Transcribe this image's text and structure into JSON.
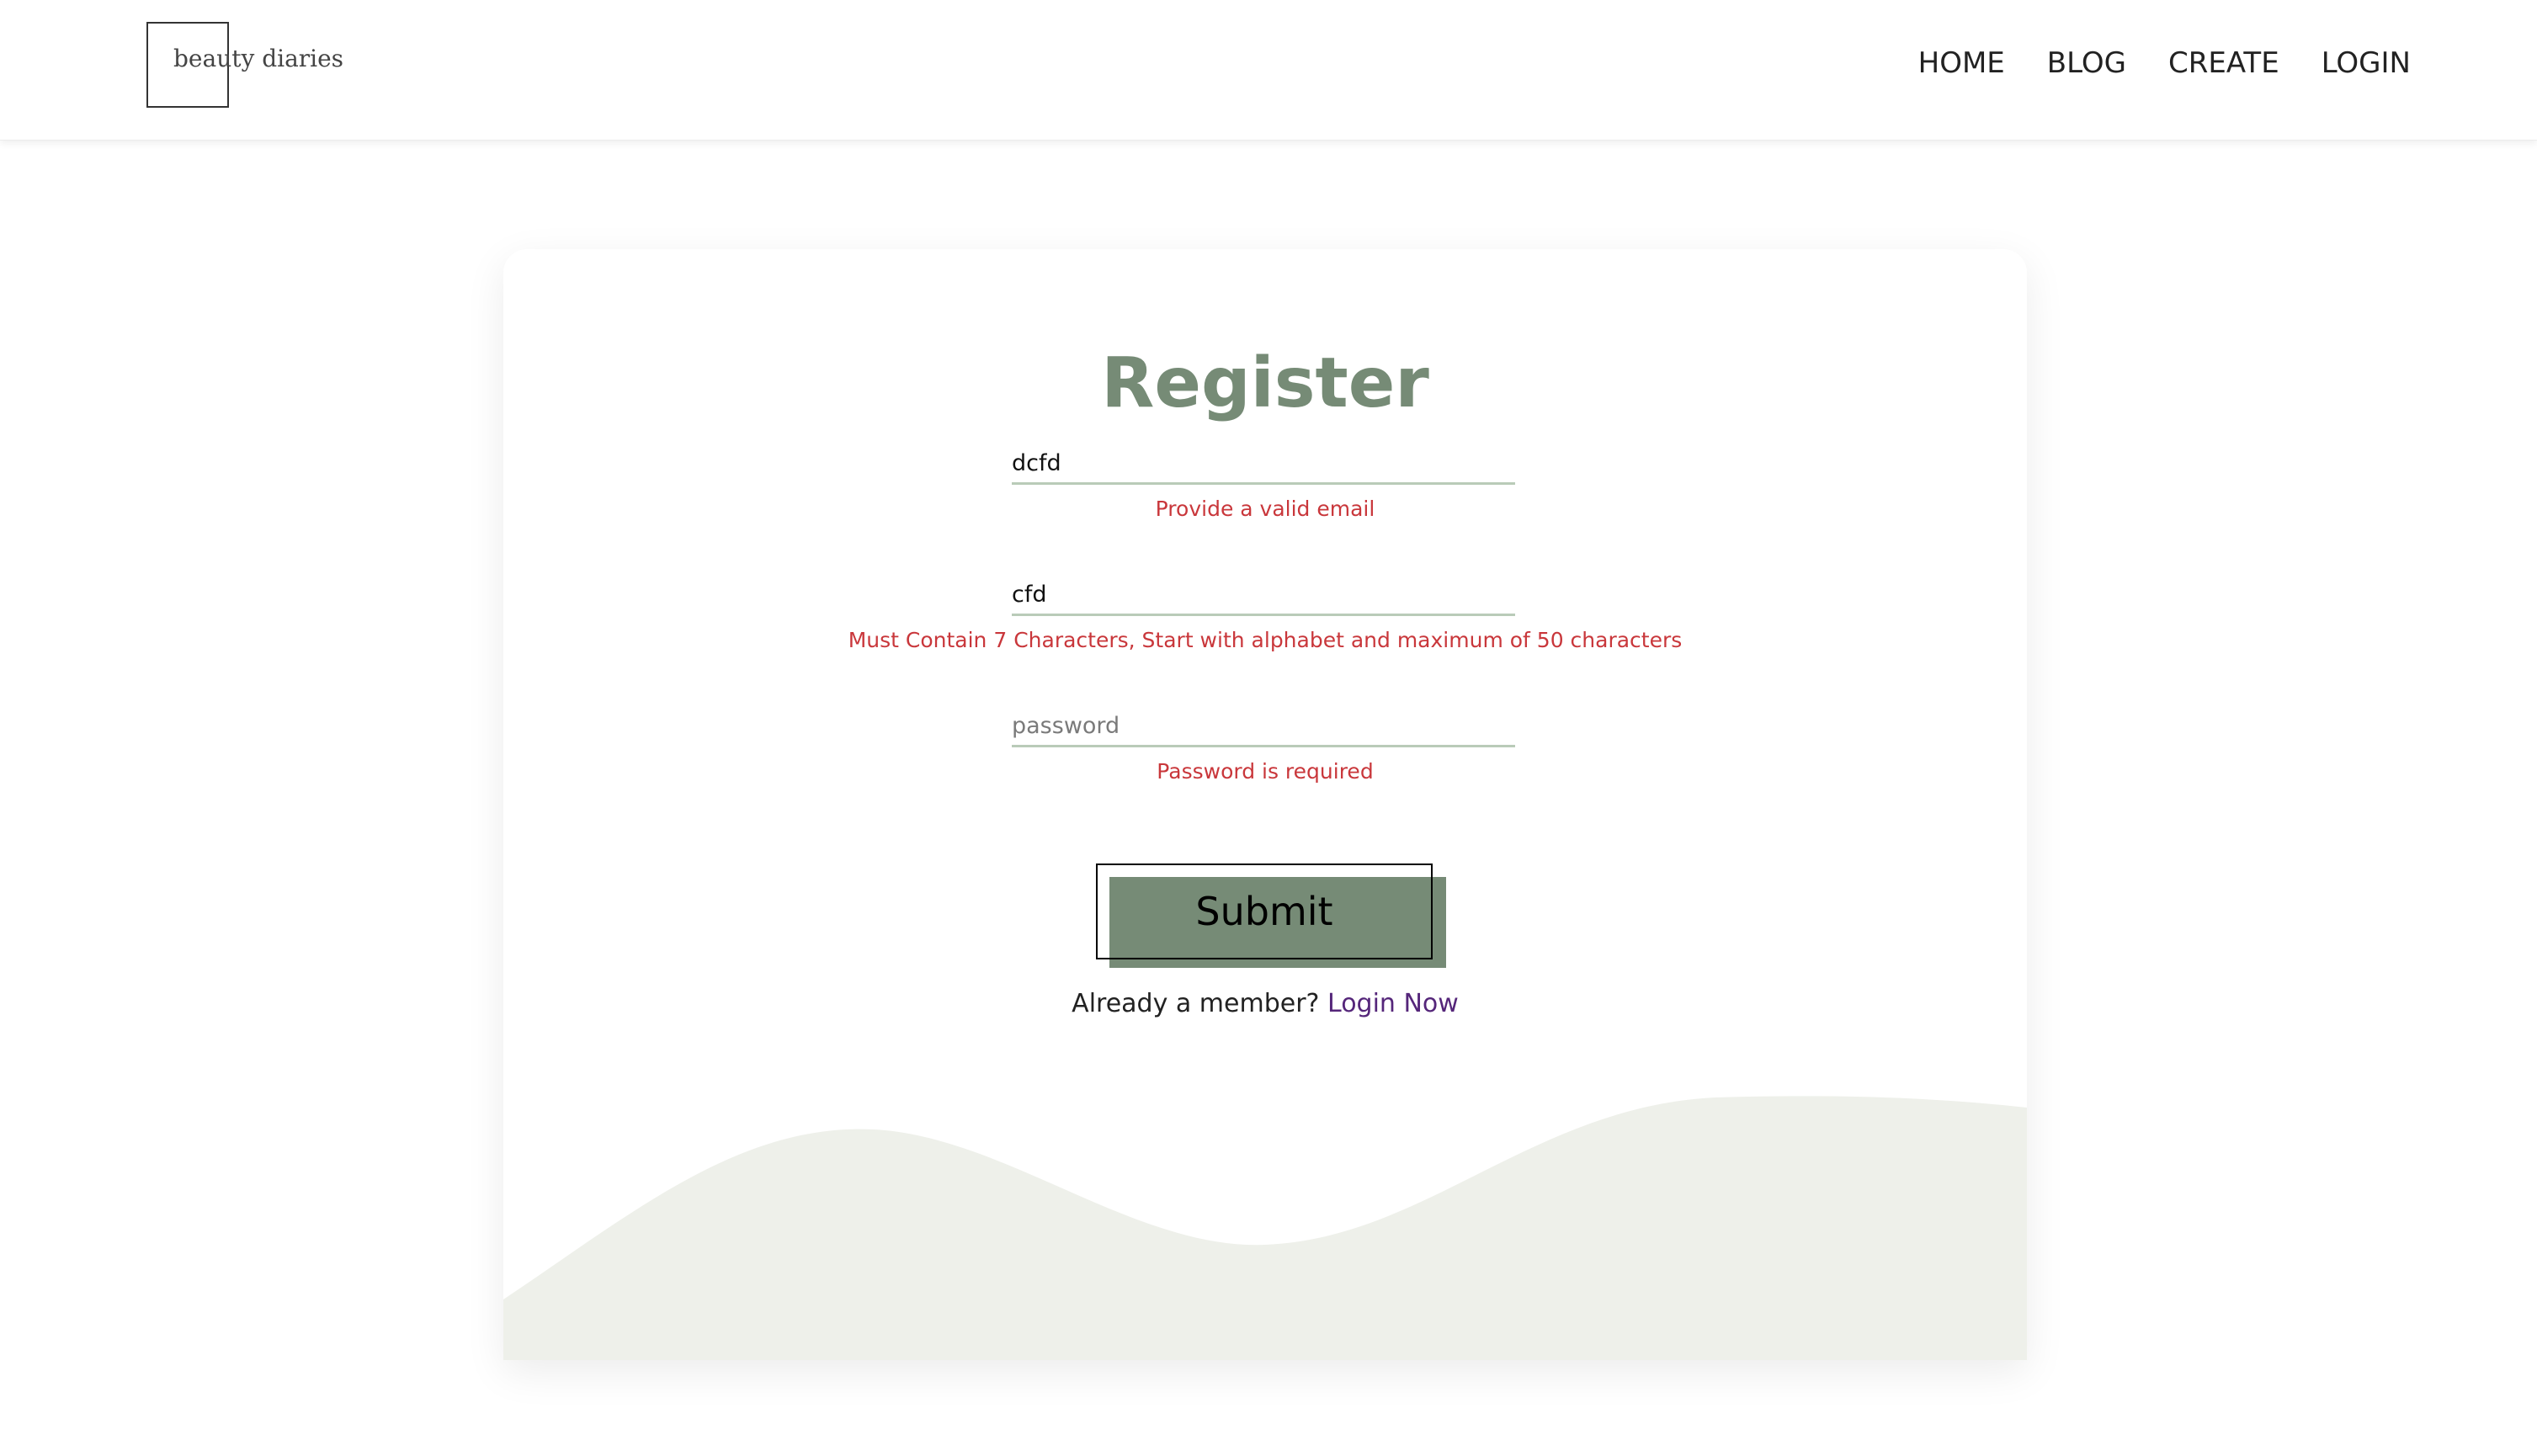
{
  "header": {
    "logo_text": "beauty diaries",
    "nav": {
      "home": "HOME",
      "blog": "BLOG",
      "create": "CREATE",
      "login": "LOGIN"
    }
  },
  "form": {
    "title": "Register",
    "email": {
      "value": "dcfd",
      "error": "Provide a valid email"
    },
    "username": {
      "value": "cfd",
      "error": "Must Contain 7 Characters, Start with alphabet and maximum of 50 characters"
    },
    "password": {
      "value": "",
      "placeholder": "password",
      "error": "Password is required"
    },
    "submit_label": "Submit",
    "member_text": "Already a member?",
    "login_link": "Login Now"
  },
  "colors": {
    "accent": "#768b76",
    "error": "#c9373b",
    "link": "#55267a",
    "wave": "#eef0ea"
  }
}
